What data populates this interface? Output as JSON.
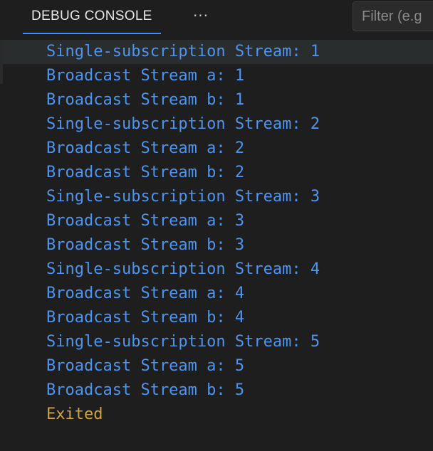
{
  "tabbar": {
    "active_tab": "DEBUG CONSOLE",
    "more_label": "···",
    "filter_placeholder": "Filter (e.g"
  },
  "console": {
    "lines": [
      "Single-subscription Stream: 1",
      "Broadcast Stream a: 1",
      "Broadcast Stream b: 1",
      "Single-subscription Stream: 2",
      "Broadcast Stream a: 2",
      "Broadcast Stream b: 2",
      "Single-subscription Stream: 3",
      "Broadcast Stream a: 3",
      "Broadcast Stream b: 3",
      "Single-subscription Stream: 4",
      "Broadcast Stream a: 4",
      "Broadcast Stream b: 4",
      "Single-subscription Stream: 5",
      "Broadcast Stream a: 5",
      "Broadcast Stream b: 5"
    ],
    "exit_message": "Exited"
  },
  "colors": {
    "background": "#1e1e1e",
    "output_text": "#4e94ef",
    "exit_text": "#cca43e",
    "tab_underline": "#3794ff"
  }
}
